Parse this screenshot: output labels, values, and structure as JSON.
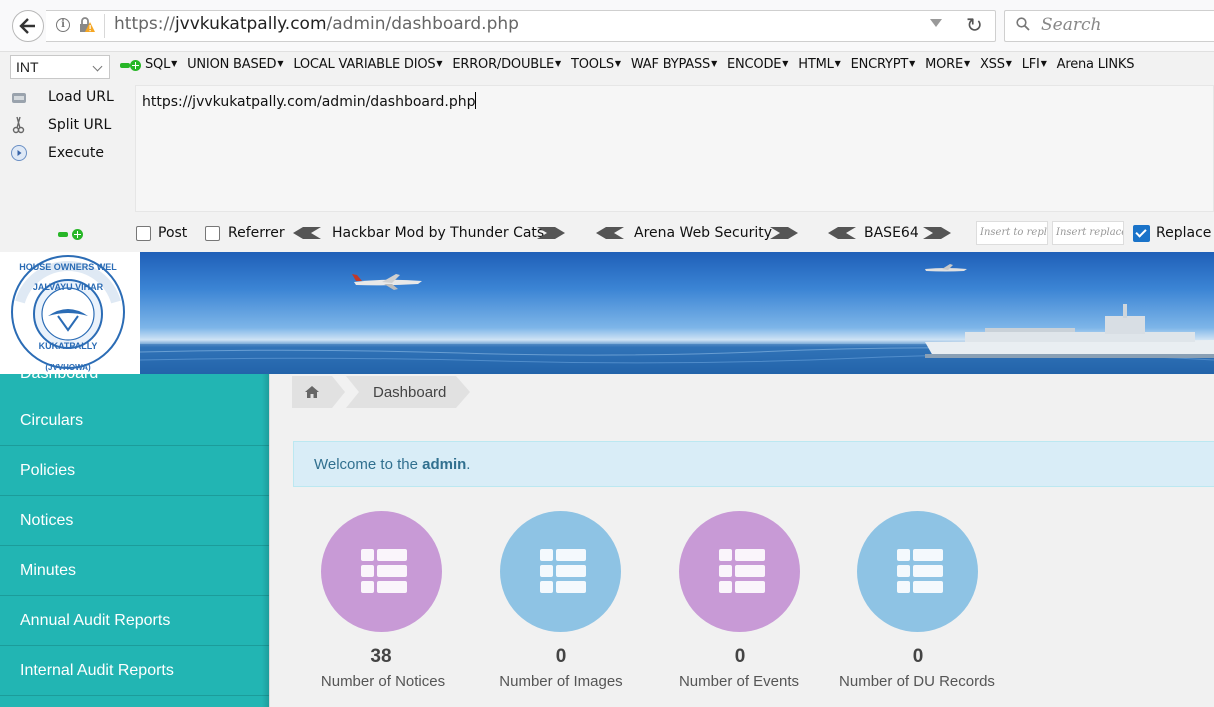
{
  "browser": {
    "url_prefix": "https://",
    "url_host": "jvvkukatpally.com",
    "url_path": "/admin/dashboard.php",
    "search_placeholder": "Search"
  },
  "hackbar": {
    "select_value": "INT",
    "menu": [
      "SQL",
      "UNION BASED",
      "LOCAL VARIABLE DIOS",
      "ERROR/DOUBLE",
      "TOOLS",
      "WAF BYPASS",
      "ENCODE",
      "HTML",
      "ENCRYPT",
      "MORE",
      "XSS",
      "LFI",
      "Arena LINKS"
    ],
    "actions": {
      "load": "Load URL",
      "split": "Split URL",
      "execute": "Execute"
    },
    "url_value": "https://jvvkukatpally.com/admin/dashboard.php",
    "post_label": "Post",
    "referrer_label": "Referrer",
    "labels": [
      "Hackbar Mod by Thunder Cats",
      "Arena Web Security",
      "BASE64"
    ],
    "insert_placeholder_1": "Insert to repl",
    "insert_placeholder_2": "Insert replace",
    "replace_label": "Replace",
    "replace_checked": true
  },
  "site": {
    "logo_text": "JALVAYU VIHAR HOUSE OWNERS WELFARE ASSOCIATION KUKATPALLY (JVVHOWA)",
    "sidebar": {
      "partial_item": "Dashboard",
      "items": [
        "Circulars",
        "Policies",
        "Notices",
        "Minutes",
        "Annual Audit Reports",
        "Internal Audit Reports"
      ]
    },
    "breadcrumb": {
      "current": "Dashboard"
    },
    "welcome": {
      "prefix": "Welcome to the ",
      "user": "admin",
      "suffix": "."
    },
    "stats": [
      {
        "value": "38",
        "label": "Number of Notices",
        "color": "#c89ad6"
      },
      {
        "value": "0",
        "label": "Number of Images",
        "color": "#8ec3e4"
      },
      {
        "value": "0",
        "label": "Number of Events",
        "color": "#c89ad6"
      },
      {
        "value": "0",
        "label": "Number of DU Records",
        "color": "#8ec3e4"
      }
    ]
  }
}
